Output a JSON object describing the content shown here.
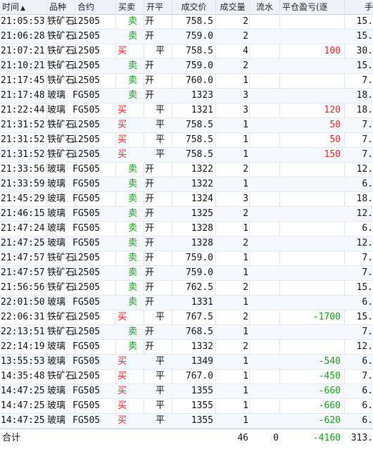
{
  "header": {
    "time": "时间",
    "sort_arrow": "▲",
    "variety": "品种",
    "contract": "合约",
    "buysell": "买卖",
    "openclose": "开平",
    "price": "成交价",
    "volume": "成交量",
    "flow": "流水",
    "close_pnl": "平仓盈亏(逐",
    "fee": "手"
  },
  "colors": {
    "buy": "#e02424",
    "sell": "#1a9a1a"
  },
  "rows": [
    {
      "time": "21:05:53",
      "variety": "铁矿石",
      "contract": "i2505",
      "bs": "卖",
      "bs_type": "sell",
      "oc": "开",
      "oc_pos": "open",
      "price": "758.5",
      "volume": "2",
      "pnl": "",
      "pnl_type": "",
      "fee": "15."
    },
    {
      "time": "21:06:28",
      "variety": "铁矿石",
      "contract": "i2505",
      "bs": "卖",
      "bs_type": "sell",
      "oc": "开",
      "oc_pos": "open",
      "price": "759.0",
      "volume": "2",
      "pnl": "",
      "pnl_type": "",
      "fee": "15."
    },
    {
      "time": "21:07:21",
      "variety": "铁矿石",
      "contract": "i2505",
      "bs": "买",
      "bs_type": "buy",
      "oc": "平",
      "oc_pos": "close",
      "price": "758.5",
      "volume": "4",
      "pnl": "100",
      "pnl_type": "pos",
      "fee": "30."
    },
    {
      "time": "21:10:21",
      "variety": "铁矿石",
      "contract": "i2505",
      "bs": "卖",
      "bs_type": "sell",
      "oc": "开",
      "oc_pos": "open",
      "price": "759.0",
      "volume": "2",
      "pnl": "",
      "pnl_type": "",
      "fee": "15."
    },
    {
      "time": "21:17:45",
      "variety": "铁矿石",
      "contract": "i2505",
      "bs": "卖",
      "bs_type": "sell",
      "oc": "开",
      "oc_pos": "open",
      "price": "760.0",
      "volume": "1",
      "pnl": "",
      "pnl_type": "",
      "fee": "7."
    },
    {
      "time": "21:17:48",
      "variety": "玻璃",
      "contract": "FG505",
      "bs": "卖",
      "bs_type": "sell",
      "oc": "开",
      "oc_pos": "open",
      "price": "1323",
      "volume": "3",
      "pnl": "",
      "pnl_type": "",
      "fee": "18."
    },
    {
      "time": "21:22:44",
      "variety": "玻璃",
      "contract": "FG505",
      "bs": "买",
      "bs_type": "buy",
      "oc": "平",
      "oc_pos": "close",
      "price": "1321",
      "volume": "3",
      "pnl": "120",
      "pnl_type": "pos",
      "fee": "18."
    },
    {
      "time": "21:31:52",
      "variety": "铁矿石",
      "contract": "i2505",
      "bs": "买",
      "bs_type": "buy",
      "oc": "平",
      "oc_pos": "close",
      "price": "758.5",
      "volume": "1",
      "pnl": "50",
      "pnl_type": "pos",
      "fee": "7."
    },
    {
      "time": "21:31:52",
      "variety": "铁矿石",
      "contract": "i2505",
      "bs": "买",
      "bs_type": "buy",
      "oc": "平",
      "oc_pos": "close",
      "price": "758.5",
      "volume": "1",
      "pnl": "50",
      "pnl_type": "pos",
      "fee": "7."
    },
    {
      "time": "21:31:52",
      "variety": "铁矿石",
      "contract": "i2505",
      "bs": "买",
      "bs_type": "buy",
      "oc": "平",
      "oc_pos": "close",
      "price": "758.5",
      "volume": "1",
      "pnl": "150",
      "pnl_type": "pos",
      "fee": "7."
    },
    {
      "time": "21:33:56",
      "variety": "玻璃",
      "contract": "FG505",
      "bs": "卖",
      "bs_type": "sell",
      "oc": "开",
      "oc_pos": "open",
      "price": "1322",
      "volume": "2",
      "pnl": "",
      "pnl_type": "",
      "fee": "12."
    },
    {
      "time": "21:33:59",
      "variety": "玻璃",
      "contract": "FG505",
      "bs": "卖",
      "bs_type": "sell",
      "oc": "开",
      "oc_pos": "open",
      "price": "1322",
      "volume": "1",
      "pnl": "",
      "pnl_type": "",
      "fee": "6."
    },
    {
      "time": "21:45:29",
      "variety": "玻璃",
      "contract": "FG505",
      "bs": "卖",
      "bs_type": "sell",
      "oc": "开",
      "oc_pos": "open",
      "price": "1324",
      "volume": "3",
      "pnl": "",
      "pnl_type": "",
      "fee": "18."
    },
    {
      "time": "21:46:15",
      "variety": "玻璃",
      "contract": "FG505",
      "bs": "卖",
      "bs_type": "sell",
      "oc": "开",
      "oc_pos": "open",
      "price": "1325",
      "volume": "2",
      "pnl": "",
      "pnl_type": "",
      "fee": "12."
    },
    {
      "time": "21:47:24",
      "variety": "玻璃",
      "contract": "FG505",
      "bs": "卖",
      "bs_type": "sell",
      "oc": "开",
      "oc_pos": "open",
      "price": "1328",
      "volume": "1",
      "pnl": "",
      "pnl_type": "",
      "fee": "6."
    },
    {
      "time": "21:47:25",
      "variety": "玻璃",
      "contract": "FG505",
      "bs": "卖",
      "bs_type": "sell",
      "oc": "开",
      "oc_pos": "open",
      "price": "1328",
      "volume": "2",
      "pnl": "",
      "pnl_type": "",
      "fee": "12."
    },
    {
      "time": "21:47:57",
      "variety": "铁矿石",
      "contract": "i2505",
      "bs": "卖",
      "bs_type": "sell",
      "oc": "开",
      "oc_pos": "open",
      "price": "759.0",
      "volume": "1",
      "pnl": "",
      "pnl_type": "",
      "fee": "7."
    },
    {
      "time": "21:47:57",
      "variety": "铁矿石",
      "contract": "i2505",
      "bs": "卖",
      "bs_type": "sell",
      "oc": "开",
      "oc_pos": "open",
      "price": "759.0",
      "volume": "1",
      "pnl": "",
      "pnl_type": "",
      "fee": "7."
    },
    {
      "time": "21:56:56",
      "variety": "铁矿石",
      "contract": "i2505",
      "bs": "卖",
      "bs_type": "sell",
      "oc": "开",
      "oc_pos": "open",
      "price": "762.5",
      "volume": "2",
      "pnl": "",
      "pnl_type": "",
      "fee": "15."
    },
    {
      "time": "22:01:50",
      "variety": "玻璃",
      "contract": "FG505",
      "bs": "卖",
      "bs_type": "sell",
      "oc": "开",
      "oc_pos": "open",
      "price": "1331",
      "volume": "1",
      "pnl": "",
      "pnl_type": "",
      "fee": "6."
    },
    {
      "time": "22:06:31",
      "variety": "铁矿石",
      "contract": "i2505",
      "bs": "买",
      "bs_type": "buy",
      "oc": "平",
      "oc_pos": "close",
      "price": "767.5",
      "volume": "2",
      "pnl": "-1700",
      "pnl_type": "neg",
      "fee": "15."
    },
    {
      "time": "22:13:51",
      "variety": "铁矿石",
      "contract": "i2505",
      "bs": "卖",
      "bs_type": "sell",
      "oc": "开",
      "oc_pos": "open",
      "price": "768.5",
      "volume": "1",
      "pnl": "",
      "pnl_type": "",
      "fee": "7."
    },
    {
      "time": "22:14:19",
      "variety": "玻璃",
      "contract": "FG505",
      "bs": "卖",
      "bs_type": "sell",
      "oc": "开",
      "oc_pos": "open",
      "price": "1332",
      "volume": "2",
      "pnl": "",
      "pnl_type": "",
      "fee": "12."
    },
    {
      "time": "13:55:53",
      "variety": "玻璃",
      "contract": "FG505",
      "bs": "买",
      "bs_type": "buy",
      "oc": "平",
      "oc_pos": "close",
      "price": "1349",
      "volume": "1",
      "pnl": "-540",
      "pnl_type": "neg",
      "fee": "6."
    },
    {
      "time": "14:35:48",
      "variety": "铁矿石",
      "contract": "i2505",
      "bs": "买",
      "bs_type": "buy",
      "oc": "平",
      "oc_pos": "close",
      "price": "767.0",
      "volume": "1",
      "pnl": "-450",
      "pnl_type": "neg",
      "fee": "7."
    },
    {
      "time": "14:47:25",
      "variety": "玻璃",
      "contract": "FG505",
      "bs": "买",
      "bs_type": "buy",
      "oc": "平",
      "oc_pos": "close",
      "price": "1355",
      "volume": "1",
      "pnl": "-660",
      "pnl_type": "neg",
      "fee": "6."
    },
    {
      "time": "14:47:25",
      "variety": "玻璃",
      "contract": "FG505",
      "bs": "买",
      "bs_type": "buy",
      "oc": "平",
      "oc_pos": "close",
      "price": "1355",
      "volume": "1",
      "pnl": "-660",
      "pnl_type": "neg",
      "fee": "6."
    },
    {
      "time": "14:47:25",
      "variety": "玻璃",
      "contract": "FG505",
      "bs": "买",
      "bs_type": "buy",
      "oc": "平",
      "oc_pos": "close",
      "price": "1355",
      "volume": "1",
      "pnl": "-620",
      "pnl_type": "neg",
      "fee": "6."
    }
  ],
  "footer": {
    "label": "合计",
    "volume": "46",
    "flow": "0",
    "pnl": "-4160",
    "fee": "313."
  }
}
